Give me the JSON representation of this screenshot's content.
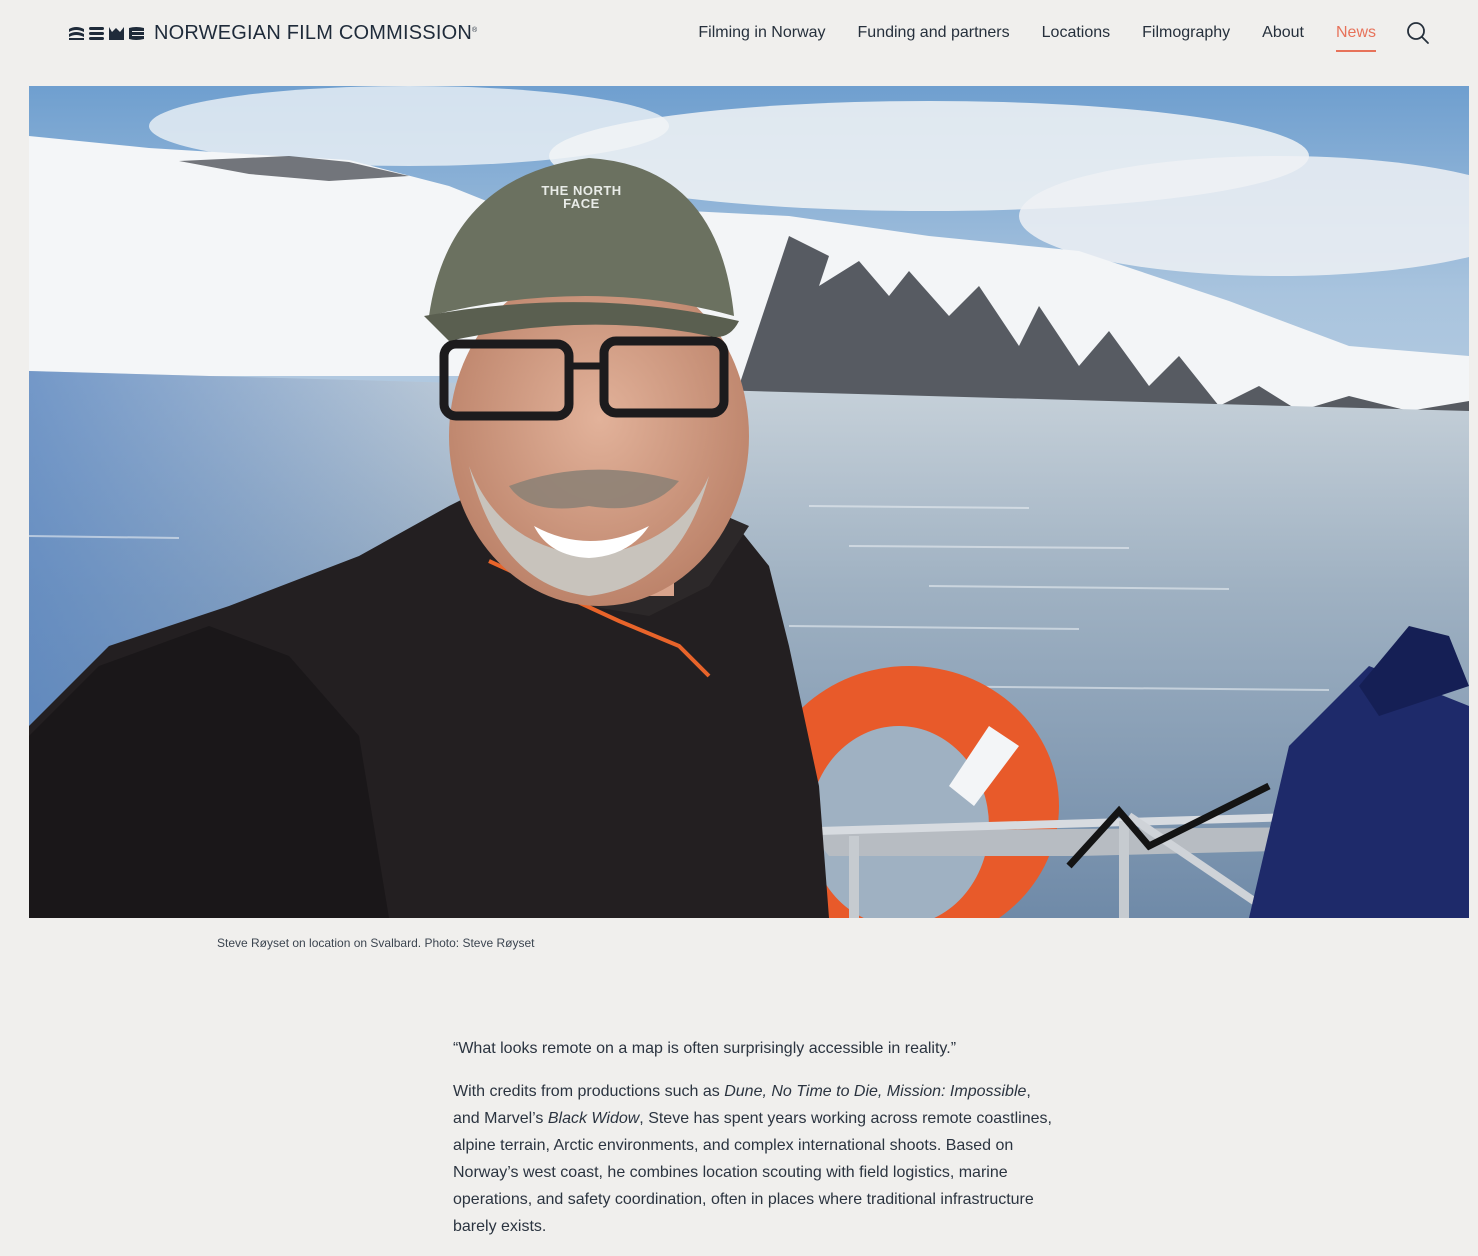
{
  "brand": {
    "name": "NORWEGIAN FILM COMMISSION",
    "registered_mark": "®",
    "logo_icon": "nfc-logo-mark"
  },
  "nav": {
    "items": [
      {
        "label": "Filming in Norway",
        "active": false
      },
      {
        "label": "Funding and partners",
        "active": false
      },
      {
        "label": "Locations",
        "active": false
      },
      {
        "label": "Filmography",
        "active": false
      },
      {
        "label": "About",
        "active": false
      },
      {
        "label": "News",
        "active": true
      }
    ],
    "search_icon": "search-icon",
    "accent_color": "#e7725a"
  },
  "hero": {
    "subject": "photo-selfie-svalbard-fjord",
    "caption": "Steve Røyset on location on Svalbard. Photo: Steve Røyset",
    "cap_text": "THE NORTH FACE"
  },
  "article": {
    "quote": "“What looks remote on a map is often surprisingly accessible in reality.”",
    "p2": {
      "t1": "With credits from productions such as ",
      "e1": "Dune, No Time to Die, Mission: Impossible",
      "t2": ", and Marvel’s ",
      "e2": "Black Widow",
      "t3": ", Steve has spent years working across remote coastlines, alpine terrain, Arctic environments, and complex international shoots. Based on Norway’s west coast, he combines location scouting with field logistics, marine operations, and safety coordination, often in places where traditional infrastructure barely exists."
    }
  }
}
